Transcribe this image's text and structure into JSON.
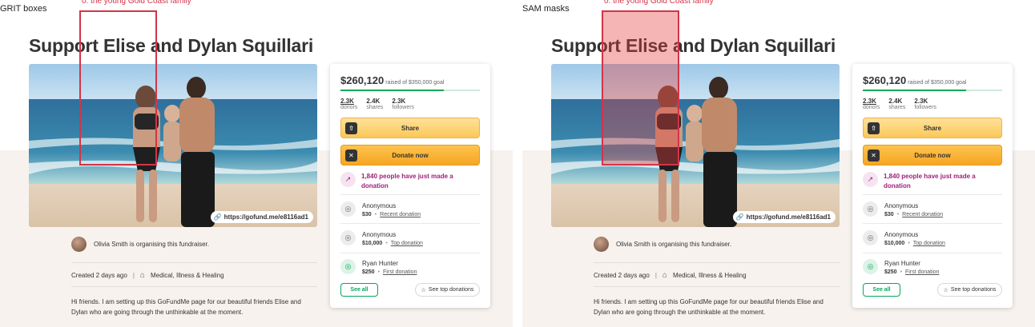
{
  "panels": [
    {
      "label": "GRIT boxes",
      "mode": "box"
    },
    {
      "label": "SAM masks",
      "mode": "mask"
    }
  ],
  "annotation": {
    "label": "0: the young Gold Coast family",
    "color": "#d33448"
  },
  "page": {
    "title": "Support Elise and Dylan Squillari",
    "link": "https://gofund.me/e8116ad1",
    "organiser": "Olivia Smith is organising this fundraiser.",
    "created": "Created 2 days ago",
    "category": "Medical, Illness & Healing",
    "story": "Hi friends. I am setting up this GoFundMe page for our beautiful friends Elise and Dylan who are going through the unthinkable at the moment."
  },
  "donate_card": {
    "raised": "$260,120",
    "goal_text": "raised of $350,000 goal",
    "progress_fraction": 0.7432,
    "stats": [
      {
        "value": "2.3K",
        "label": "donors"
      },
      {
        "value": "2.4K",
        "label": "shares"
      },
      {
        "value": "2.3K",
        "label": "followers"
      }
    ],
    "share_label": "Share",
    "donate_label": "Donate now",
    "activity": "1,840 people have just made a donation",
    "donations": [
      {
        "name": "Anonymous",
        "amount": "$30",
        "kind": "Recent donation",
        "icon": "donor-icon"
      },
      {
        "name": "Anonymous",
        "amount": "$10,000",
        "kind": "Top donation",
        "icon": "donor-icon"
      },
      {
        "name": "Ryan Hunter",
        "amount": "$250",
        "kind": "First donation",
        "icon": "donor-icon"
      }
    ],
    "see_all_label": "See all",
    "see_top_label": "See top donations"
  },
  "colors": {
    "accent_green": "#02a95c",
    "activity_purple": "#a01e79",
    "share_button": "#fbc858",
    "donate_button": "#f5a623"
  }
}
